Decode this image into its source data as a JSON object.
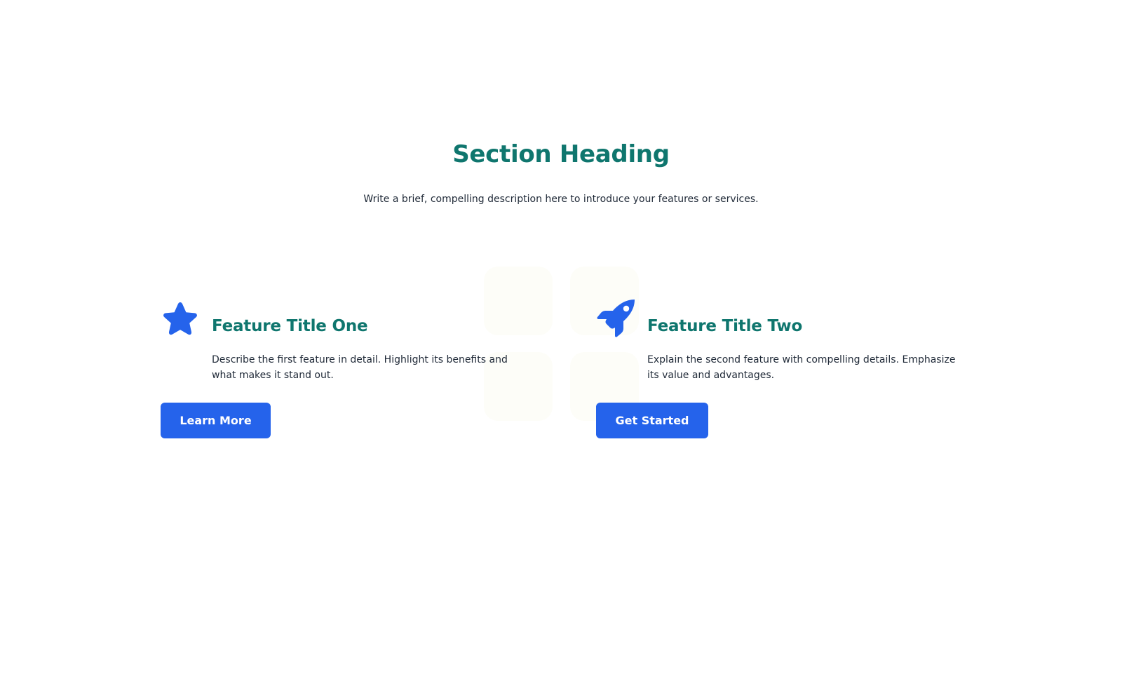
{
  "section": {
    "heading": "Section Heading",
    "description": "Write a brief, compelling description here to introduce your features or services."
  },
  "features": [
    {
      "icon": "star-icon",
      "title": "Feature Title One",
      "description": "Describe the first feature in detail. Highlight its benefits and what makes it stand out.",
      "button_label": "Learn More"
    },
    {
      "icon": "rocket-icon",
      "title": "Feature Title Two",
      "description": "Explain the second feature with compelling details. Emphasize its value and advantages.",
      "button_label": "Get Started"
    }
  ],
  "colors": {
    "heading": "#0f766e",
    "accent": "#2563eb",
    "text": "#1f2937",
    "tile": "#fdfdf8"
  }
}
